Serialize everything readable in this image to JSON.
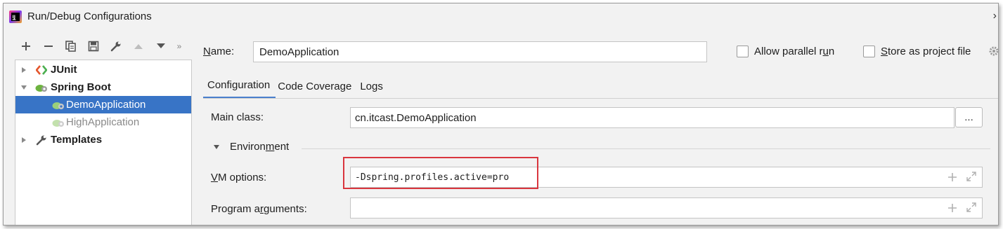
{
  "window": {
    "title": "Run/Debug Configurations"
  },
  "toolbar": {
    "icons": [
      "plus-icon",
      "minus-icon",
      "copy-icon",
      "save-icon",
      "wrench-icon",
      "move-up-icon",
      "move-down-icon",
      "more-icon"
    ],
    "more": "»"
  },
  "tree": [
    {
      "label": "JUnit",
      "icon": "junit-icon"
    },
    {
      "label": "Spring Boot",
      "icon": "spring-boot-icon"
    },
    {
      "label": "DemoApplication",
      "icon": "spring-app-icon",
      "selected": true
    },
    {
      "label": "HighApplication",
      "icon": "spring-app-icon"
    },
    {
      "label": "Templates",
      "icon": "wrench-icon"
    }
  ],
  "name": {
    "label": "Name:",
    "value": "DemoApplication"
  },
  "options": {
    "allow_parallel": {
      "label": "Allow parallel run",
      "checked": false
    },
    "store_project": {
      "label": "Store as project file",
      "checked": false
    }
  },
  "tabs": [
    "Configuration",
    "Code Coverage",
    "Logs"
  ],
  "config": {
    "main_class": {
      "label": "Main class:",
      "value": "cn.itcast.DemoApplication",
      "browse": "..."
    },
    "environment": {
      "label": "Environment"
    },
    "vm_options": {
      "label": "VM options:",
      "value": "-Dspring.profiles.active=pro"
    },
    "program_args": {
      "label": "Program arguments:",
      "value": ""
    }
  },
  "colors": {
    "selection": "#3874c6",
    "tab_accent": "#4a7fcd",
    "highlight": "#d9363e"
  }
}
